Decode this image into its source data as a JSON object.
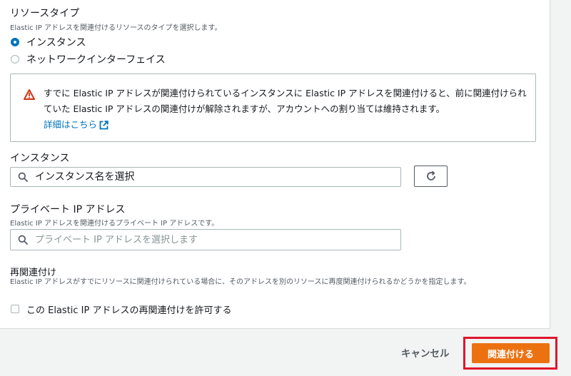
{
  "resource_type": {
    "label": "リソースタイプ",
    "description": "Elastic IP アドレスを関連付けるリソースのタイプを選択します。",
    "options": [
      {
        "label": "インスタンス",
        "selected": true
      },
      {
        "label": "ネットワークインターフェイス",
        "selected": false
      }
    ]
  },
  "alert": {
    "text": "すでに Elastic IP アドレスが関連付けられているインスタンスに Elastic IP アドレスを関連付けると、前に関連付けられていた Elastic IP アドレスの関連付けが解除されますが、アカウントへの割り当ては維持されます。",
    "link_label": "詳細はこちら",
    "icon": "warning-icon",
    "icon_color": "#d13212"
  },
  "instance": {
    "label": "インスタンス",
    "placeholder": "インスタンス名を選択",
    "refresh_icon": "refresh-icon"
  },
  "private_ip": {
    "label": "プライベート IP アドレス",
    "description": "Elastic IP アドレスを関連付けるプライベート IP アドレスです。",
    "placeholder": "プライベート IP アドレスを選択します"
  },
  "reassociation": {
    "label": "再関連付け",
    "description": "Elastic IP アドレスがすでにリソースに関連付けられている場合に、そのアドレスを別のリソースに再度関連付けられるかどうかを指定します。",
    "checkbox_label": "この Elastic IP アドレスの再関連付けを許可する",
    "checked": false
  },
  "footer": {
    "cancel_label": "キャンセル",
    "submit_label": "関連付ける"
  },
  "colors": {
    "accent": "#0073bb",
    "primary_button": "#ec7211",
    "highlight_outline": "#e0162b"
  }
}
